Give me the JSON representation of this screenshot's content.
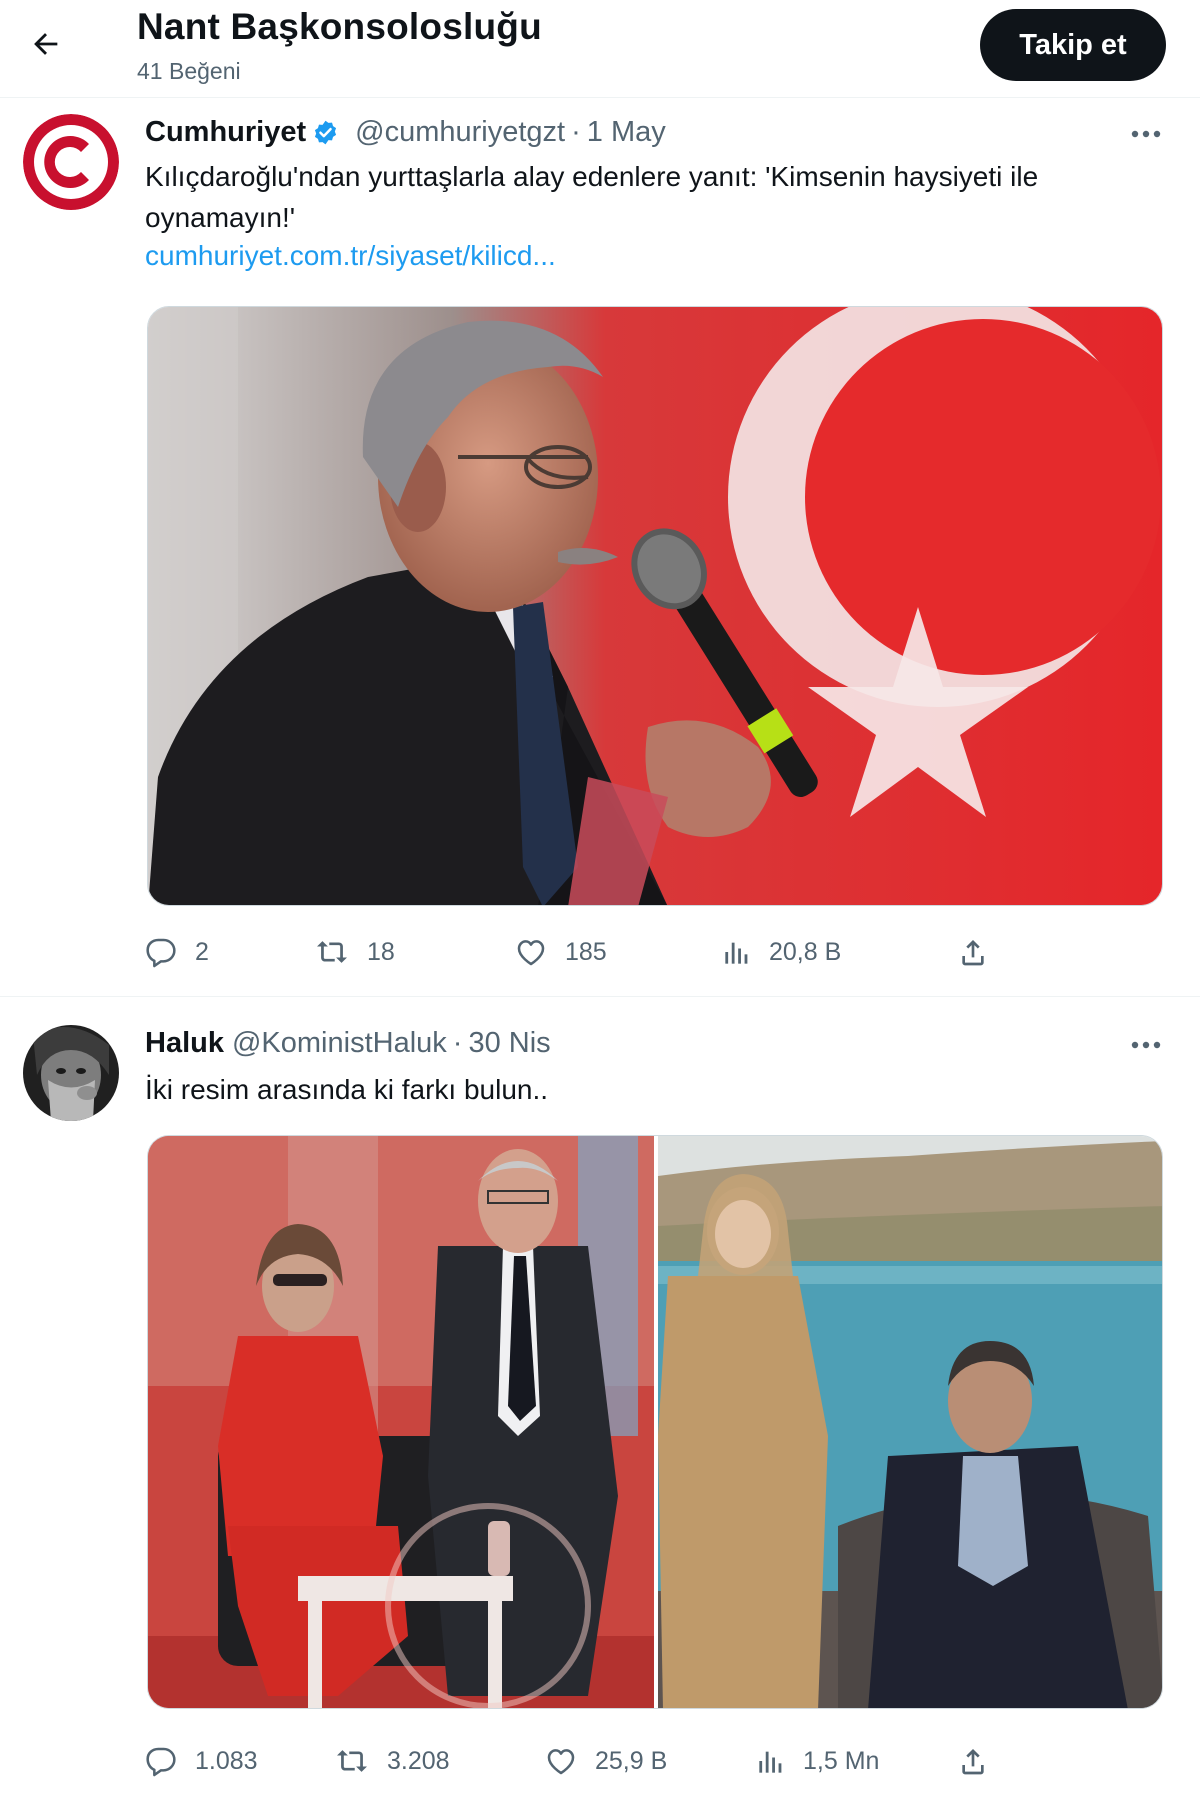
{
  "header": {
    "back_icon": "arrow-left-icon",
    "title": "Nant Başkonsolosluğu",
    "subtitle": "41 Beğeni",
    "follow_label": "Takip et"
  },
  "tweets": [
    {
      "name": "Cumhuriyet",
      "verified": true,
      "handle": "@cumhuriyetgzt",
      "separator": "·",
      "date": "1 May",
      "text": "Kılıçdaroğlu'ndan yurttaşlarla alay edenlere yanıt: 'Kimsenin haysiyeti ile oynamayın!'",
      "link": "cumhuriyet.com.tr/siyaset/kilicd...",
      "media": "photo-politician-microphone-turkish-flag",
      "stats": {
        "replies": "2",
        "retweets": "18",
        "likes": "185",
        "views": "20,8 B"
      }
    },
    {
      "name": "Haluk",
      "verified": false,
      "handle": "@KoministHaluk",
      "separator": "·",
      "date": "30 Nis",
      "text": "İki resim arasında ki farkı bulun..",
      "media": "two-photo-comparison",
      "stats": {
        "replies": "1.083",
        "retweets": "3.208",
        "likes": "25,9 B",
        "views": "1,5 Mn"
      }
    }
  ],
  "icons": [
    "arrow-left-icon",
    "verified-badge-icon",
    "more-icon",
    "reply-icon",
    "retweet-icon",
    "like-icon",
    "views-icon",
    "share-icon"
  ],
  "colors": {
    "accent": "#1d9bf0",
    "text": "#0f1419",
    "muted": "#536471",
    "brand_red": "#c8102e"
  }
}
